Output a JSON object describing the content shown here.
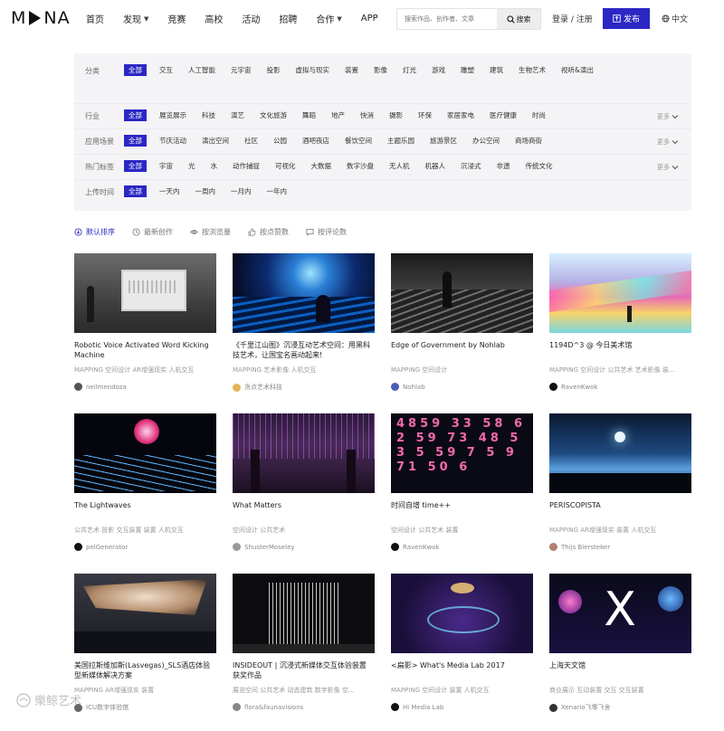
{
  "header": {
    "logo_left": "M",
    "logo_right": "NA",
    "nav": [
      {
        "label": "首页",
        "caret": false
      },
      {
        "label": "发现",
        "caret": true
      },
      {
        "label": "竞赛",
        "caret": false
      },
      {
        "label": "高校",
        "caret": false
      },
      {
        "label": "活动",
        "caret": false
      },
      {
        "label": "招聘",
        "caret": false
      },
      {
        "label": "合作",
        "caret": true
      },
      {
        "label": "APP",
        "caret": false
      }
    ],
    "search_placeholder": "搜索作品、创作者、文章",
    "search_button": "搜索",
    "login": "登录 / 注册",
    "publish": "发布",
    "lang": "中文"
  },
  "filters": [
    {
      "label": "分类",
      "tags": [
        "全部",
        "交互",
        "人工智能",
        "元宇宙",
        "投影",
        "虚拟与现实",
        "装置",
        "影像",
        "灯光",
        "游戏",
        "雕塑",
        "建筑",
        "生物艺术",
        "视听&演出"
      ],
      "more": ""
    },
    {
      "label": "行业",
      "tags": [
        "全部",
        "展览展示",
        "科技",
        "演艺",
        "文化旅游",
        "舞蹈",
        "地产",
        "快消",
        "摄影",
        "环保",
        "家居家电",
        "医疗健康",
        "时尚"
      ],
      "more": "更多"
    },
    {
      "label": "应用场景",
      "tags": [
        "全部",
        "节庆活动",
        "演出空间",
        "社区",
        "公园",
        "酒吧夜店",
        "餐饮空间",
        "主题乐园",
        "旅游景区",
        "办公空间",
        "商场商街"
      ],
      "more": "更多"
    },
    {
      "label": "热门标签",
      "tags": [
        "全部",
        "宇宙",
        "光",
        "水",
        "动作捕捉",
        "可视化",
        "大数据",
        "数字沙盘",
        "无人机",
        "机器人",
        "沉浸式",
        "非遗",
        "传统文化"
      ],
      "more": "更多"
    },
    {
      "label": "上传时间",
      "tags": [
        "全部",
        "一天内",
        "一周内",
        "一月内",
        "一年内"
      ],
      "more": ""
    }
  ],
  "sort": [
    {
      "label": "默认排序",
      "icon": "sort-icon"
    },
    {
      "label": "最新创作",
      "icon": "clock-icon"
    },
    {
      "label": "按浏览量",
      "icon": "eye-icon"
    },
    {
      "label": "按点赞数",
      "icon": "thumb-up-icon"
    },
    {
      "label": "按评论数",
      "icon": "comment-icon"
    }
  ],
  "cards": [
    {
      "title": "Robotic Voice Activated Word Kicking Machine",
      "tags": "MAPPING  空间设计  AR增强现实  人机交互",
      "author": "neilmendoza",
      "avatar_color": "#555555",
      "thumb": "t1"
    },
    {
      "title": "《千里江山图》沉浸互动艺术空间：用黑科技艺术，让国宝名画动起来!",
      "tags": "MAPPING  艺术影像  人机交互",
      "author": "贪点艺术科技",
      "avatar_color": "#e4b45a",
      "thumb": "t2"
    },
    {
      "title": "Edge of Government by Nohlab",
      "tags": "MAPPING  空间设计",
      "author": "Nohlab",
      "avatar_color": "#4a5fb5",
      "thumb": "t3"
    },
    {
      "title": "1194D^3 @ 今日美术馆",
      "tags": "MAPPING  空间设计  公共艺术  艺术影像  装...",
      "author": "RavenKwok",
      "avatar_color": "#111111",
      "thumb": "t4"
    },
    {
      "title": "The Lightwaves",
      "tags": "公共艺术  投影  交互装置  装置  人机交互",
      "author": "pelGenerator",
      "avatar_color": "#111111",
      "thumb": "t5"
    },
    {
      "title": "What Matters",
      "tags": "空间设计  公共艺术",
      "author": "ShusterMoseley",
      "avatar_color": "#999999",
      "thumb": "t6"
    },
    {
      "title": "时间自增 time++",
      "tags": "空间设计  公共艺术  装置",
      "author": "RavenKwok",
      "avatar_color": "#111111",
      "thumb": "t7"
    },
    {
      "title": "PERISCOPISTA",
      "tags": "MAPPING  AR增强现实  装置  人机交互",
      "author": "Thijs Biersteker",
      "avatar_color": "#b08070",
      "thumb": "t8"
    },
    {
      "title": "美国拉斯维加斯(Lasvegas)_SLS酒店体验型新媒体解决方案",
      "tags": "MAPPING  AR增强现实  装置",
      "author": "ICU数字体验馆",
      "avatar_color": "#666666",
      "thumb": "t9"
    },
    {
      "title": "INSIDEOUT | 沉浸式新媒体交互体验装置 获奖作品",
      "tags": "展览空间  公共艺术  动态建筑  数字影像  空...",
      "author": "flora&faunavisions",
      "avatar_color": "#888888",
      "thumb": "t10"
    },
    {
      "title": "<扁影> What's Media Lab 2017",
      "tags": "MAPPING  空间设计  装置  人机交互",
      "author": "Hi Media Lab",
      "avatar_color": "#111111",
      "thumb": "t11"
    },
    {
      "title": "上海天文馆",
      "tags": "商业展示  互动装置  交互  交互装置",
      "author": "Xenario飞零飞舍",
      "avatar_color": "#333333",
      "thumb": "t12"
    }
  ],
  "watermark": "樂鲸艺术"
}
